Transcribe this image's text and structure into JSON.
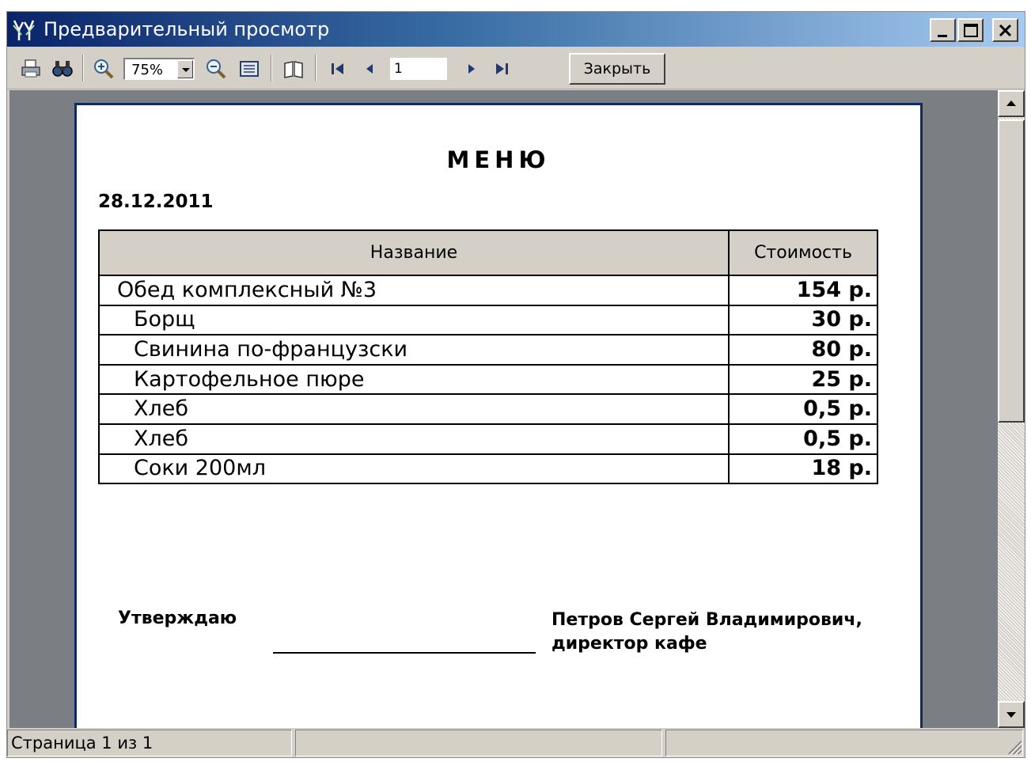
{
  "window": {
    "title": "Предварительный просмотр"
  },
  "toolbar": {
    "zoom_value": "75%",
    "page_number": "1",
    "close_label": "Закрыть",
    "icons": [
      "print-icon",
      "find-icon",
      "zoom-in-icon",
      "zoom-out-icon",
      "page-width-icon",
      "page-setup-icon",
      "first-page-icon",
      "prev-page-icon",
      "next-page-icon",
      "last-page-icon"
    ]
  },
  "document": {
    "title": "МЕНЮ",
    "date": "28.12.2011",
    "table": {
      "headers": [
        "Название",
        "Стоимость"
      ],
      "rows": [
        {
          "name": "Обед комплексный №3",
          "price": "154 р."
        },
        {
          "name": "Борщ",
          "price": "30 р."
        },
        {
          "name": "Свинина по-французски",
          "price": "80 р."
        },
        {
          "name": "Картофельное пюре",
          "price": "25 р."
        },
        {
          "name": "Хлеб",
          "price": "0,5 р."
        },
        {
          "name": "Хлеб",
          "price": "0,5 р."
        },
        {
          "name": "Соки 200мл",
          "price": "18 р."
        }
      ]
    },
    "approve_label": "Утверждаю",
    "signer_name": "Петров Сергей Владимирович,",
    "signer_position": "директор кафе"
  },
  "statusbar": {
    "page_status": "Страница 1 из 1",
    "pane2": "",
    "pane3": ""
  },
  "colors": {
    "title_bar_start": "#0a246a",
    "title_bar_end": "#a6caf0",
    "preview_background": "#7b7f83",
    "page_border": "#0f2b61",
    "header_fill": "#d4d0c8",
    "chrome": "#d4d0c8"
  }
}
